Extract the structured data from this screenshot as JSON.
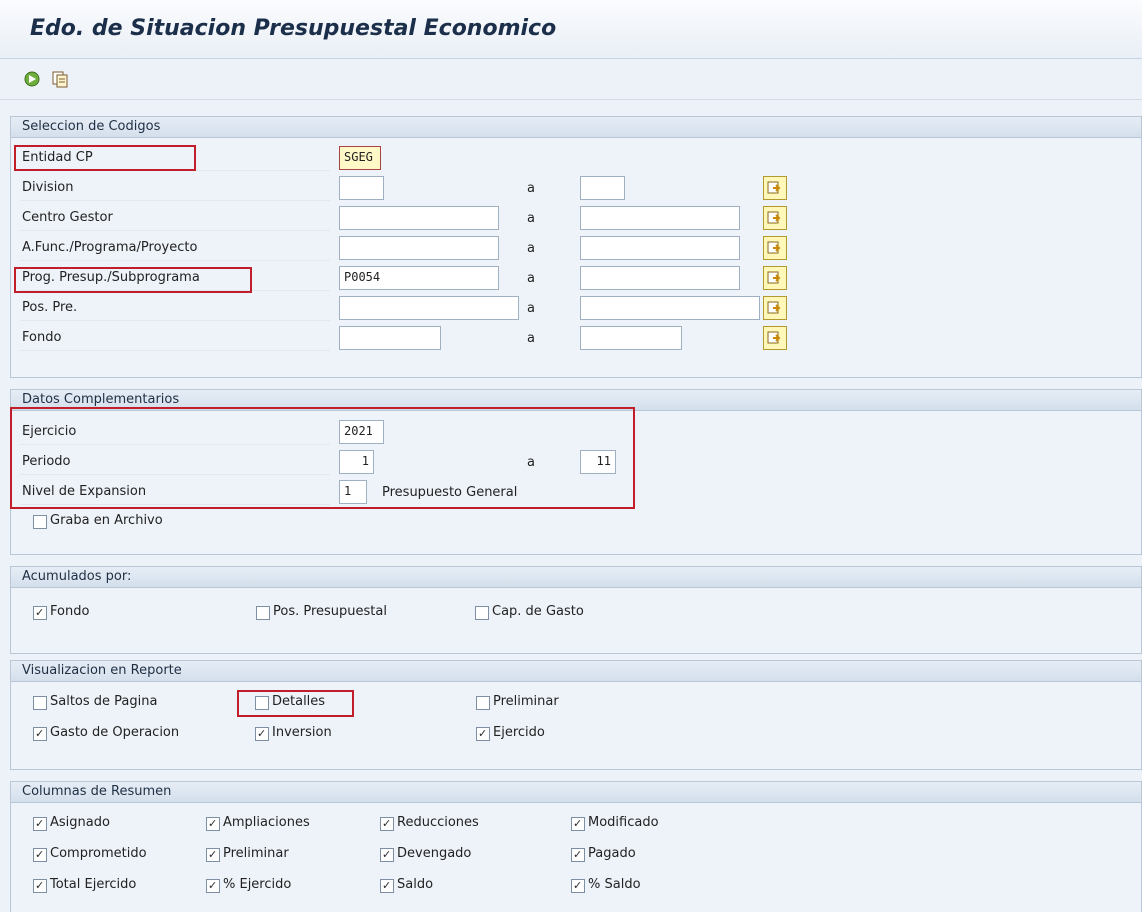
{
  "window": {
    "title": "Edo. de Situacion Presupuestal Economico"
  },
  "toolbar": [
    {
      "name": "execute-icon"
    },
    {
      "name": "variant-icon"
    }
  ],
  "seleccion": {
    "header": "Seleccion de Codigos",
    "to_label": "a",
    "rows": [
      {
        "label": "Entidad CP",
        "from": "SGEG",
        "to": null
      },
      {
        "label": "Division",
        "from": "",
        "to": ""
      },
      {
        "label": "Centro Gestor",
        "from": "",
        "to": ""
      },
      {
        "label": "A.Func./Programa/Proyecto",
        "from": "",
        "to": ""
      },
      {
        "label": "Prog. Presup./Subprograma",
        "from": "P0054",
        "to": ""
      },
      {
        "label": "Pos. Pre.",
        "from": "",
        "to": ""
      },
      {
        "label": "Fondo",
        "from": "",
        "to": ""
      }
    ]
  },
  "datos": {
    "header": "Datos Complementarios",
    "ejercicio_label": "Ejercicio",
    "ejercicio": "2021",
    "periodo_label": "Periodo",
    "periodo_from": "1",
    "periodo_to_label": "a",
    "periodo_to": "11",
    "nivel_label": "Nivel de Expansion",
    "nivel": "1",
    "nivel_text": "Presupuesto General",
    "graba_label": "Graba en Archivo",
    "graba_checked": false
  },
  "acumulados": {
    "header": "Acumulados por:",
    "items": [
      {
        "label": "Fondo",
        "checked": true
      },
      {
        "label": "Pos. Presupuestal",
        "checked": false
      },
      {
        "label": "Cap. de Gasto",
        "checked": false
      }
    ]
  },
  "visualizacion": {
    "header": "Visualizacion en Reporte",
    "items": [
      {
        "label": "Saltos de Pagina",
        "checked": false
      },
      {
        "label": "Detalles",
        "checked": false
      },
      {
        "label": "Preliminar",
        "checked": false
      },
      {
        "label": "Gasto de Operacion",
        "checked": true
      },
      {
        "label": "Inversion",
        "checked": true
      },
      {
        "label": "Ejercido",
        "checked": true
      }
    ]
  },
  "columnas": {
    "header": "Columnas de Resumen",
    "items": [
      {
        "label": "Asignado",
        "checked": true
      },
      {
        "label": "Ampliaciones",
        "checked": true
      },
      {
        "label": "Reducciones",
        "checked": true
      },
      {
        "label": "Modificado",
        "checked": true
      },
      {
        "label": "Comprometido",
        "checked": true
      },
      {
        "label": "Preliminar",
        "checked": true
      },
      {
        "label": "Devengado",
        "checked": true
      },
      {
        "label": "Pagado",
        "checked": true
      },
      {
        "label": "Total Ejercido",
        "checked": true
      },
      {
        "label": "% Ejercido",
        "checked": true
      },
      {
        "label": "Saldo",
        "checked": true
      },
      {
        "label": "% Saldo",
        "checked": true
      }
    ]
  },
  "colors": {
    "highlight": "#c11d2b",
    "accent": "#1c2f4a"
  }
}
